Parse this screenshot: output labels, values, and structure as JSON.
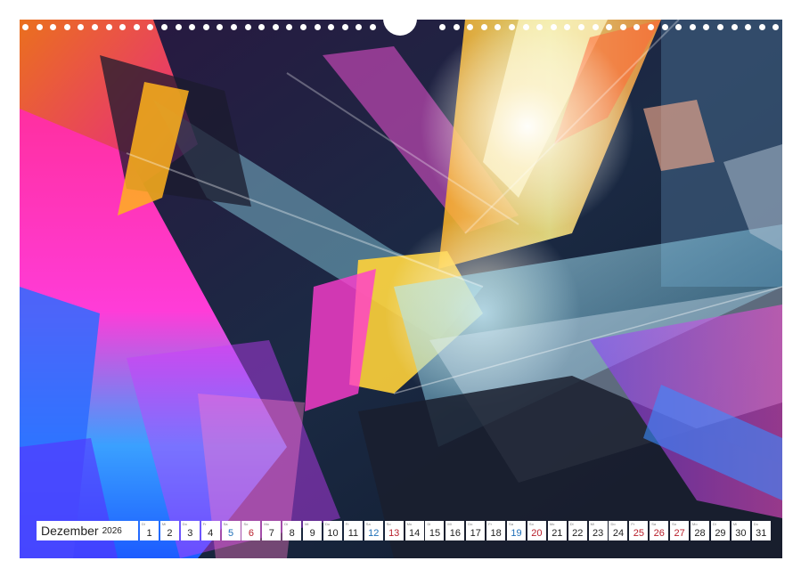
{
  "calendar": {
    "month": "Dezember",
    "year": "2026",
    "days": [
      {
        "n": "1",
        "dow": "Di",
        "type": "weekday"
      },
      {
        "n": "2",
        "dow": "Mi",
        "type": "weekday"
      },
      {
        "n": "3",
        "dow": "Do",
        "type": "weekday"
      },
      {
        "n": "4",
        "dow": "Fr",
        "type": "weekday"
      },
      {
        "n": "5",
        "dow": "Sa",
        "type": "sat"
      },
      {
        "n": "6",
        "dow": "So",
        "type": "sun"
      },
      {
        "n": "7",
        "dow": "Mo",
        "type": "weekday"
      },
      {
        "n": "8",
        "dow": "Di",
        "type": "weekday"
      },
      {
        "n": "9",
        "dow": "Mi",
        "type": "weekday"
      },
      {
        "n": "10",
        "dow": "Do",
        "type": "weekday"
      },
      {
        "n": "11",
        "dow": "Fr",
        "type": "weekday"
      },
      {
        "n": "12",
        "dow": "Sa",
        "type": "sat"
      },
      {
        "n": "13",
        "dow": "So",
        "type": "sun"
      },
      {
        "n": "14",
        "dow": "Mo",
        "type": "weekday"
      },
      {
        "n": "15",
        "dow": "Di",
        "type": "weekday"
      },
      {
        "n": "16",
        "dow": "Mi",
        "type": "weekday"
      },
      {
        "n": "17",
        "dow": "Do",
        "type": "weekday"
      },
      {
        "n": "18",
        "dow": "Fr",
        "type": "weekday"
      },
      {
        "n": "19",
        "dow": "Sa",
        "type": "sat"
      },
      {
        "n": "20",
        "dow": "So",
        "type": "sun"
      },
      {
        "n": "21",
        "dow": "Mo",
        "type": "weekday"
      },
      {
        "n": "22",
        "dow": "Di",
        "type": "weekday"
      },
      {
        "n": "23",
        "dow": "Mi",
        "type": "weekday"
      },
      {
        "n": "24",
        "dow": "Do",
        "type": "weekday"
      },
      {
        "n": "25",
        "dow": "Fr",
        "type": "hol"
      },
      {
        "n": "26",
        "dow": "Sa",
        "type": "hol"
      },
      {
        "n": "27",
        "dow": "So",
        "type": "sun"
      },
      {
        "n": "28",
        "dow": "Mo",
        "type": "weekday"
      },
      {
        "n": "29",
        "dow": "Di",
        "type": "weekday"
      },
      {
        "n": "30",
        "dow": "Mi",
        "type": "weekday"
      },
      {
        "n": "31",
        "dow": "Do",
        "type": "weekday"
      }
    ]
  },
  "colors": {
    "saturday": "#1e6fb8",
    "sunday_holiday": "#b81e2a",
    "weekday": "#222222"
  },
  "binding": {
    "icon": "spiral-binding-holes"
  }
}
